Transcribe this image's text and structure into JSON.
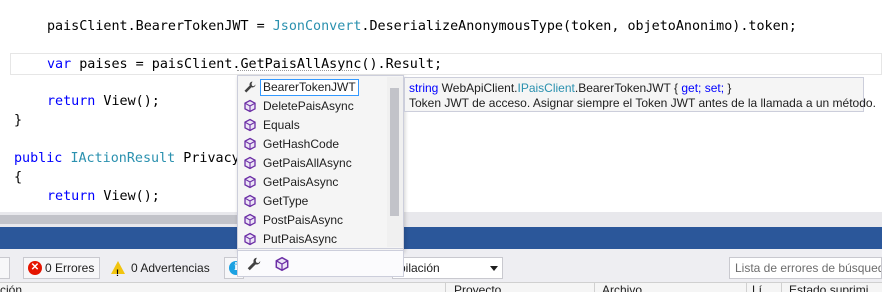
{
  "editor": {
    "line1": {
      "a": "paisClient.BearerTokenJWT = ",
      "b": "JsonConvert",
      "c": ".DeserializeAnonymousType(token, objetoAnonimo).token;"
    },
    "line2": {
      "kw": "var",
      "a": " paises = paisClient.GetPaisAllAsync().Result;"
    },
    "line3": {
      "kw": "return",
      "a": " View();"
    },
    "line4": {
      "a": "}"
    },
    "line5": {
      "kw": "public",
      "ty": "IActionResult",
      "a": " Privacy"
    },
    "line6": {
      "a": "{"
    },
    "line7": {
      "kw": "return",
      "a": " View();"
    }
  },
  "completion": {
    "items": [
      {
        "label": "BearerTokenJWT",
        "icon": "wrench-icon"
      },
      {
        "label": "DeletePaisAsync",
        "icon": "method-cube-icon"
      },
      {
        "label": "Equals",
        "icon": "method-cube-icon"
      },
      {
        "label": "GetHashCode",
        "icon": "method-cube-icon"
      },
      {
        "label": "GetPaisAllAsync",
        "icon": "method-cube-icon"
      },
      {
        "label": "GetPaisAsync",
        "icon": "method-cube-icon"
      },
      {
        "label": "GetType",
        "icon": "method-cube-icon"
      },
      {
        "label": "PostPaisAsync",
        "icon": "method-cube-icon"
      },
      {
        "label": "PutPaisAsync",
        "icon": "method-cube-icon"
      }
    ],
    "filters": [
      "wrench-icon",
      "method-cube-icon"
    ]
  },
  "quickinfo": {
    "kw": "string",
    "ns": " WebApiClient.",
    "ty": "IPaisClient",
    "member": ".BearerTokenJWT { ",
    "get": "get;",
    "set": "set;",
    "close": " }",
    "doc": "Token JWT de acceso. Asignar siempre el Token JWT antes de la llamada a un método."
  },
  "errorlist": {
    "errors": "0 Errores",
    "warnings": "0 Advertencias",
    "scope": "pilación",
    "search_placeholder": "Lista de errores de búsqueda",
    "columns": [
      "ción",
      "Proyecto",
      "Archivo",
      "Lí",
      "Estado suprimi"
    ]
  },
  "colors": {
    "keyword": "#0000ff",
    "type": "#2b91af",
    "panel_title": "#2b579a",
    "error": "#e51400",
    "warning": "#f1c40f",
    "method": "#6c2fa6",
    "selection_border": "#3399ff"
  }
}
